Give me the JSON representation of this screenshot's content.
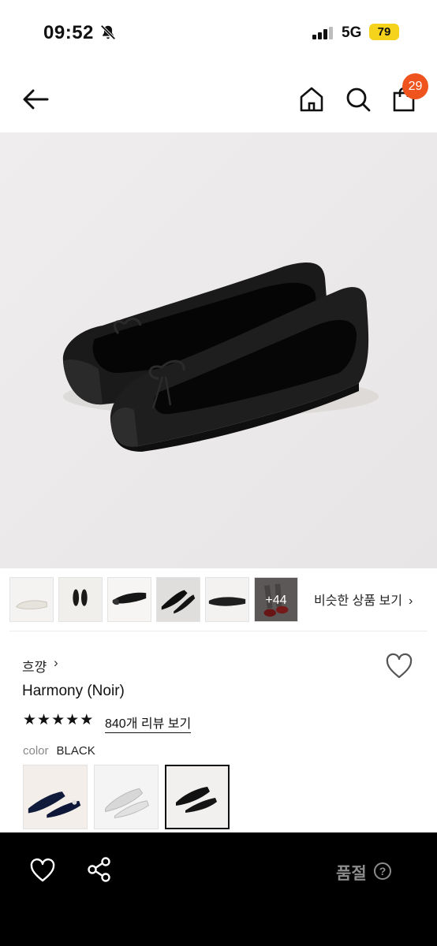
{
  "status_bar": {
    "time": "09:52",
    "network": "5G",
    "battery": "79"
  },
  "header": {
    "cart_count": "29"
  },
  "icons": [
    "bell-off-icon",
    "signal-icon",
    "back-arrow-icon",
    "home-icon",
    "search-icon",
    "shopping-bag-icon",
    "heart-icon",
    "share-icon",
    "help-icon"
  ],
  "thumbnails": {
    "more_label": "+44"
  },
  "similar_link": {
    "label": "비슷한 상품 보기",
    "chevron": "›"
  },
  "product": {
    "brand": "흐꺙",
    "brand_chevron": "›",
    "name": "Harmony (Noir)",
    "rating_stars": 5,
    "reviews_label": "840개 리뷰 보기",
    "color_label": "color",
    "color_value": "BLACK"
  },
  "bottom_bar": {
    "soldout_label": "품절",
    "help_label": "?"
  },
  "colors": {
    "badge": "#f0541e",
    "battery": "#f5d31c",
    "bottom_bg": "#000000",
    "soldout_text": "#8c8c8c"
  }
}
